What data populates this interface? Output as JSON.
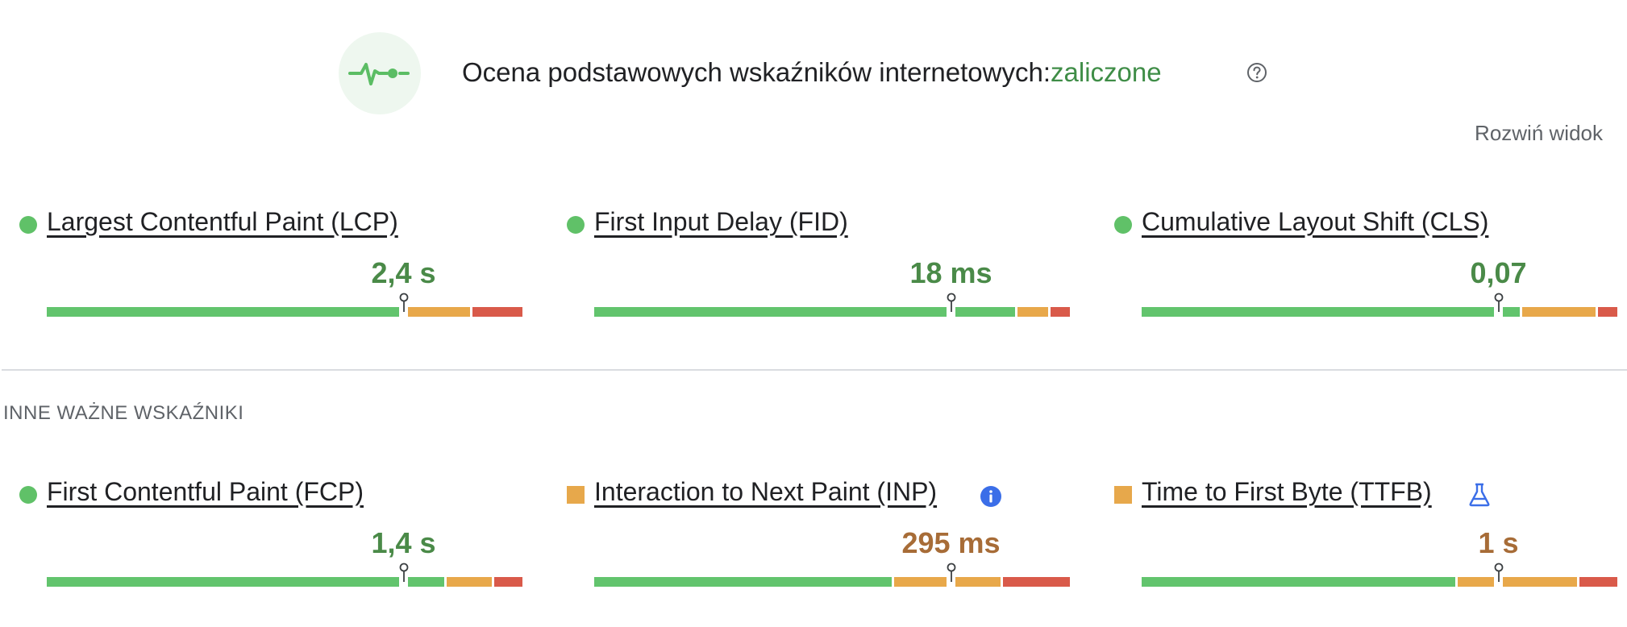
{
  "header": {
    "icon": "pulse-icon",
    "title": "Ocena podstawowych wskaźników internetowych:",
    "status": "zaliczone",
    "status_color": "#3f8d47",
    "help_icon": "question-circle-icon",
    "expand_label": "Rozwiń widok"
  },
  "core_metrics": [
    {
      "name": "Largest Contentful Paint (LCP)",
      "value": "2,4 s",
      "rating": "good",
      "marker_fraction": 0.75,
      "segments": [
        "#62c46d",
        "#e8a84a",
        "#d95a4a"
      ]
    },
    {
      "name": "First Input Delay (FID)",
      "value": "18 ms",
      "rating": "good",
      "marker_fraction": 0.75,
      "segments": [
        "#62c46d",
        "#e8a84a",
        "#d95a4a"
      ]
    },
    {
      "name": "Cumulative Layout Shift (CLS)",
      "value": "0,07",
      "rating": "good",
      "marker_fraction": 0.75,
      "segments": [
        "#62c46d",
        "#e8a84a",
        "#d95a4a"
      ]
    }
  ],
  "other_section": {
    "title": "INNE WAŻNE WSKAŹNIKI"
  },
  "other_metrics": [
    {
      "name": "First Contentful Paint (FCP)",
      "value": "1,4 s",
      "rating": "good",
      "marker_fraction": 0.75,
      "segments": [
        "#62c46d",
        "#e8a84a",
        "#d95a4a"
      ]
    },
    {
      "name": "Interaction to Next Paint (INP)",
      "value": "295 ms",
      "rating": "needs-improvement",
      "marker_fraction": 0.75,
      "extra_icon": "info-icon",
      "segments": [
        "#62c46d",
        "#e8a84a",
        "#d95a4a"
      ]
    },
    {
      "name": "Time to First Byte (TTFB)",
      "value": "1 s",
      "rating": "needs-improvement",
      "marker_fraction": 0.75,
      "extra_icon": "flask-icon",
      "segments": [
        "#62c46d",
        "#e8a84a",
        "#d95a4a"
      ]
    }
  ],
  "colors": {
    "good": "#62c46d",
    "needs_improvement": "#e8a84a",
    "poor": "#d95a4a"
  }
}
